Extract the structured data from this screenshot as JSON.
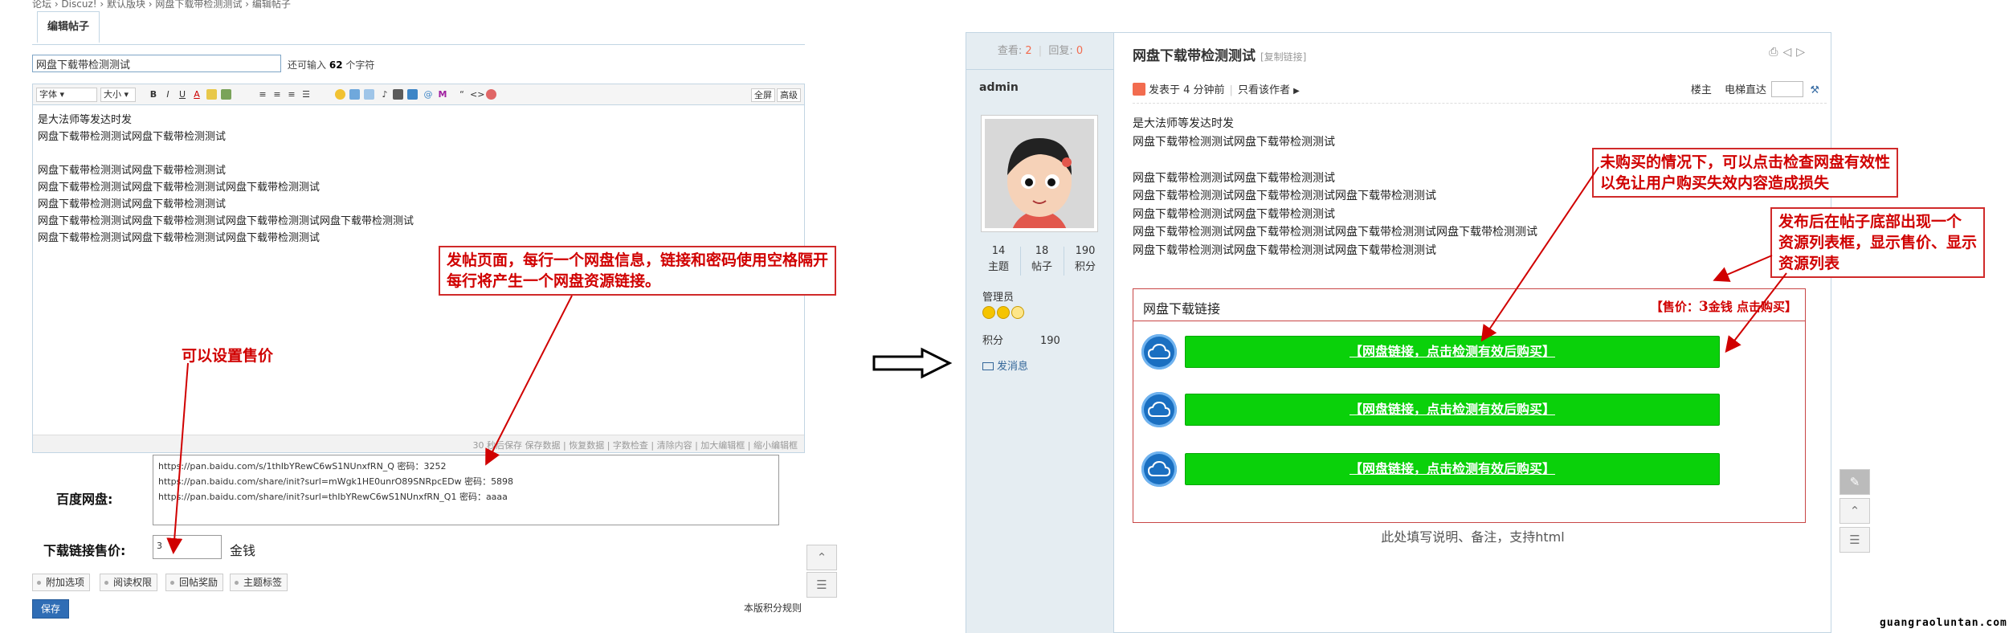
{
  "editor_page": {
    "breadcrumb": "论坛 › Discuz! › 默认版块 › 网盘下载带检测测试 › 编辑帖子",
    "tab_label": "编辑帖子",
    "subject_value": "网盘下载带检测测试",
    "subject_hint_prefix": "还可输入",
    "subject_hint_count": "62",
    "subject_hint_suffix": "个字符",
    "toolbar": {
      "font_select": "字体",
      "size_select": "大小",
      "bold": "B",
      "italic": "I",
      "underline": "U",
      "quote": "“",
      "code": "<>",
      "fullscreen": "全屏",
      "advanced": "高级"
    },
    "content_lines": [
      "是大法师等发达时发",
      "网盘下载带检测测试网盘下载带检测测试",
      "",
      "网盘下载带检测测试网盘下载带检测测试",
      "网盘下载带检测测试网盘下载带检测测试网盘下载带检测测试",
      "网盘下载带检测测试网盘下载带检测测试",
      "网盘下载带检测测试网盘下载带检测测试网盘下载带检测测试网盘下载带检测测试",
      "网盘下载带检测测试网盘下载带检测测试网盘下载带检测测试"
    ],
    "status_text": "30 秒后保存 保存数据 | 恢复数据 | 字数检查 | 清除内容 | 加大编辑框 | 缩小编辑框",
    "pan_label": "百度网盘:",
    "pan_lines": [
      "https://pan.baidu.com/s/1thIbYRewC6wS1NUnxfRN_Q 密码：3252",
      "https://pan.baidu.com/share/init?surl=mWgk1HE0unrO89SNRpcEDw 密码：5898",
      "https://pan.baidu.com/share/init?surl=thIbYRewC6wS1NUnxfRN_Q1 密码：aaaa"
    ],
    "price_label": "下载链接售价:",
    "price_value": "3",
    "price_unit": "金钱",
    "options": [
      "附加选项",
      "阅读权限",
      "回帖奖励",
      "主题标签"
    ],
    "save_label": "保存",
    "rules_link": "本版积分规则",
    "annotation_post": [
      "发帖页面，每行一个网盘信息，链接和密码使用空格隔开",
      "每行将产生一个网盘资源链接。"
    ],
    "annotation_price": "可以设置售价"
  },
  "post_page": {
    "views_label": "查看:",
    "views": "2",
    "replies_label": "回复:",
    "replies": "0",
    "title": "网盘下载带检测测试",
    "copy_link": "[复制链接]",
    "username": "admin",
    "user_stats": [
      {
        "value": "14",
        "label": "主题"
      },
      {
        "value": "18",
        "label": "帖子"
      },
      {
        "value": "190",
        "label": "积分"
      }
    ],
    "group": "管理员",
    "score_label": "积分",
    "score_value": "190",
    "send_message": "发消息",
    "posted_at": "发表于 4 分钟前",
    "only_author": "只看该作者",
    "floor_label": "楼主",
    "jump_label": "电梯直达",
    "content_lines": [
      "是大法师等发达时发",
      "网盘下载带检测测试网盘下载带检测测试",
      "",
      "网盘下载带检测测试网盘下载带检测测试",
      "网盘下载带检测测试网盘下载带检测测试网盘下载带检测测试",
      "网盘下载带检测测试网盘下载带检测测试",
      "网盘下载带检测测试网盘下载带检测测试网盘下载带检测测试网盘下载带检测测试",
      "网盘下载带检测测试网盘下载带检测测试网盘下载带检测测试"
    ],
    "download_box": {
      "title": "网盘下载链接",
      "price_prefix": "【售价：",
      "price_value": "3",
      "price_suffix": "金钱 点击购买】",
      "links": [
        "【网盘链接，点击检测有效后购买】",
        "【网盘链接，点击检测有效后购买】",
        "【网盘链接，点击检测有效后购买】"
      ]
    },
    "html_note": "此处填写说明、备注，支持html",
    "annotation_check": [
      "未购买的情况下，可以点击检查网盘有效性",
      "以免让用户购买失效内容造成损失"
    ],
    "annotation_list": [
      "发布后在帖子底部出现一个",
      "资源列表框，显示售价、显示",
      "资源列表"
    ]
  },
  "watermark": "guangraoluntan.com",
  "colors": {
    "annotation_red": "#d00000",
    "button_green": "#0ad10a",
    "sidebar_bg": "#e5edf2",
    "border_blue": "#c2d5e3",
    "save_blue": "#2f6db5"
  },
  "icons": [
    "home-icon",
    "cloud-icon",
    "print-icon",
    "prev-icon",
    "next-icon",
    "scroll-top-icon",
    "list-icon",
    "comment-icon",
    "wrench-icon",
    "mail-icon",
    "user-icon",
    "arrow-right-icon"
  ]
}
